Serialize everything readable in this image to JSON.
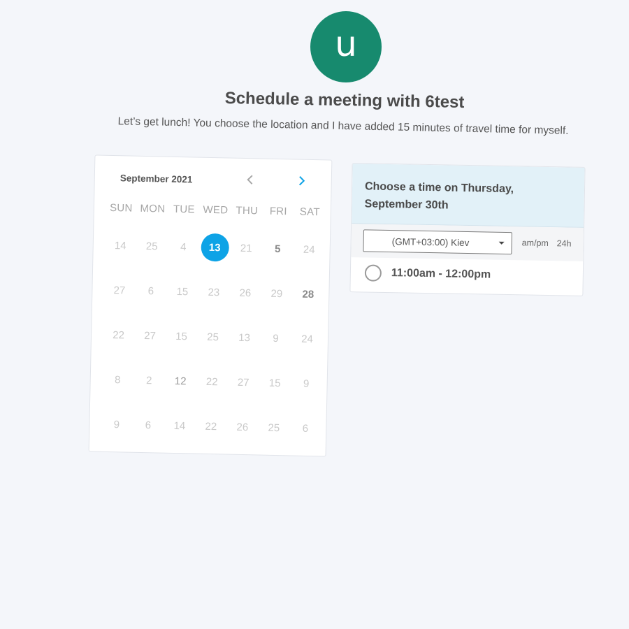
{
  "avatar": {
    "letter": "u",
    "color": "#178a6e"
  },
  "heading": {
    "title": "Schedule a meeting with 6test",
    "subtitle": "Let’s get lunch! You choose the location and I have added 15 minutes of travel time for myself."
  },
  "calendar": {
    "month_label": "September 2021",
    "prev_icon": "chevron-left-icon",
    "next_icon": "chevron-right-icon",
    "weekdays": [
      "SUN",
      "MON",
      "TUE",
      "WED",
      "THU",
      "FRI",
      "SAT"
    ],
    "weeks": [
      [
        "14",
        "25",
        "4",
        "13",
        "21",
        "5",
        "24"
      ],
      [
        "27",
        "6",
        "15",
        "23",
        "26",
        "29",
        "28"
      ],
      [
        "22",
        "27",
        "15",
        "25",
        "13",
        "9",
        "24"
      ],
      [
        "8",
        "2",
        "12",
        "22",
        "27",
        "15",
        "9"
      ],
      [
        "9",
        "6",
        "14",
        "22",
        "26",
        "25",
        "6"
      ]
    ],
    "selected_day": "13",
    "accent_color": "#0ea3e6"
  },
  "time_panel": {
    "heading_line1": "Choose a time on Thursday,",
    "heading_line2": "September 30th",
    "timezone_value": "(GMT+03:00) Kiev",
    "format_ampm": "am/pm",
    "format_24h": "24h",
    "slots": [
      {
        "label": "11:00am - 12:00pm"
      }
    ]
  }
}
